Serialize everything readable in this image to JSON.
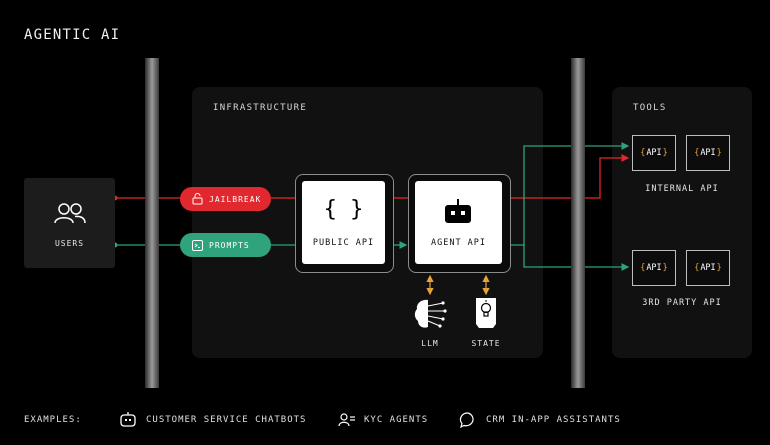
{
  "title": "AGENTIC AI",
  "infrastructure": {
    "label": "INFRASTRUCTURE"
  },
  "tools": {
    "label": "TOOLS",
    "internal_label": "INTERNAL API",
    "third_party_label": "3RD PARTY API",
    "api_text": "API",
    "brace_open": "{",
    "brace_close": "}"
  },
  "users": {
    "label": "USERS",
    "icon": "users-icon"
  },
  "inputs": {
    "jailbreak": {
      "label": "JAILBREAK",
      "color": "#e0282e",
      "icon": "jailbreak-icon"
    },
    "prompts": {
      "label": "PROMPTS",
      "color": "#2fa47c",
      "icon": "prompt-icon"
    }
  },
  "public_api": {
    "label": "PUBLIC API",
    "glyph": "{ }"
  },
  "agent_api": {
    "label": "AGENT API",
    "icon": "robot-icon"
  },
  "llm": {
    "label": "LLM",
    "icon": "brain-icon"
  },
  "state": {
    "label": "STATE",
    "icon": "document-lightbulb-icon"
  },
  "examples": {
    "label": "EXAMPLES:",
    "items": [
      {
        "label": "CUSTOMER SERVICE CHATBOTS",
        "icon": "chatbot-icon"
      },
      {
        "label": "KYC AGENTS",
        "icon": "user-list-icon"
      },
      {
        "label": "CRM IN-APP ASSISTANTS",
        "icon": "chat-bubble-icon"
      }
    ]
  },
  "colors": {
    "threat": "#e0282e",
    "safe": "#2fa47c",
    "accent": "#e8a23a",
    "background": "#000000",
    "panel": "#111111"
  }
}
